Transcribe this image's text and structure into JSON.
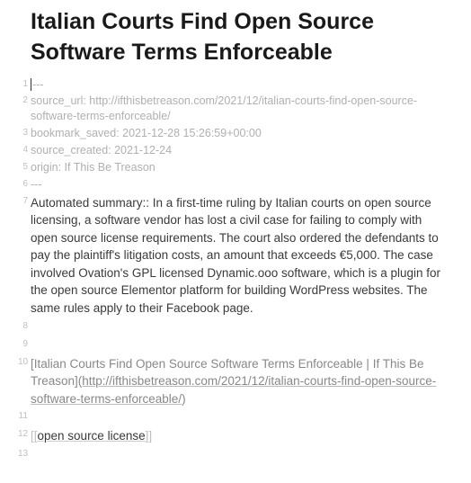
{
  "title": "Italian Courts Find Open Source Software Terms Enforceable",
  "lines": {
    "l1": "---",
    "l2": "source_url: http://ifthisbetreason.com/2021/12/italian-courts-find-open-source-software-terms-enforceable/",
    "l3": "bookmark_saved: 2021-12-28 15:26:59+00:00",
    "l4": "source_created: 2021-12-24",
    "l5": "origin: If This Be Treason",
    "l6": "---",
    "l7": "Automated summary:: In a first-time ruling by Italian courts on open source licensing, a software vendor has lost a civil case for failing to comply with open source license requirements. The court also ordered the defendants to pay the plaintiff's litigation costs, an amount that exceeds €5,000. The case involved Ovation's GPL licensed Dynamic.ooo software, which is a plugin for the open source Elementor platform for building WordPress websites. The same rules apply to their Facebook page.",
    "l10_text": "[Italian Courts Find Open Source Software Terms Enforceable | If This Be Treason]",
    "l10_url_open": "(",
    "l10_url": "http://ifthisbetreason.com/2021/12/italian-courts-find-open-source-software-terms-enforceable/",
    "l10_url_close": ")",
    "l12_open": "[[",
    "l12_text": "open source license",
    "l12_close": "]]"
  },
  "numbers": {
    "n1": "1",
    "n2": "2",
    "n3": "3",
    "n4": "4",
    "n5": "5",
    "n6": "6",
    "n7": "7",
    "n8": "8",
    "n9": "9",
    "n10": "10",
    "n11": "11",
    "n12": "12",
    "n13": "13"
  }
}
